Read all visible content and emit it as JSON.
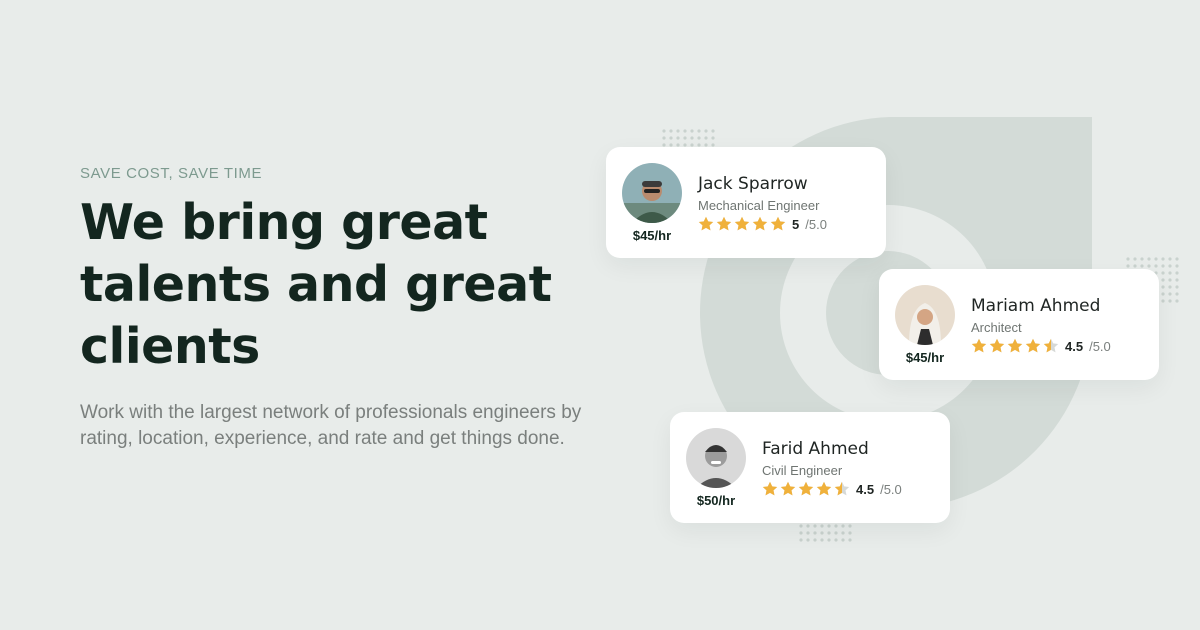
{
  "hero": {
    "eyebrow": "SAVE COST, SAVE TIME",
    "title_line1": "We bring great",
    "title_line2": "talents and great",
    "title_line3": "clients",
    "description": "Work with the largest network of professionals engineers by rating, location, experience, and rate and get things done."
  },
  "colors": {
    "background": "#e8ecea",
    "accent": "#7d9a8f",
    "star": "#f0b13b",
    "star_empty": "#d6d9d7"
  },
  "profiles": [
    {
      "name": "Jack Sparrow",
      "role": "Mechanical Engineer",
      "rate": "$45/hr",
      "rating": 5,
      "rating_label": "5",
      "out_of": "/5.0"
    },
    {
      "name": "Mariam Ahmed",
      "role": "Architect",
      "rate": "$45/hr",
      "rating": 4.5,
      "rating_label": "4.5",
      "out_of": "/5.0"
    },
    {
      "name": "Farid Ahmed",
      "role": "Civil Engineer",
      "rate": "$50/hr",
      "rating": 4.5,
      "rating_label": "4.5",
      "out_of": "/5.0"
    }
  ]
}
